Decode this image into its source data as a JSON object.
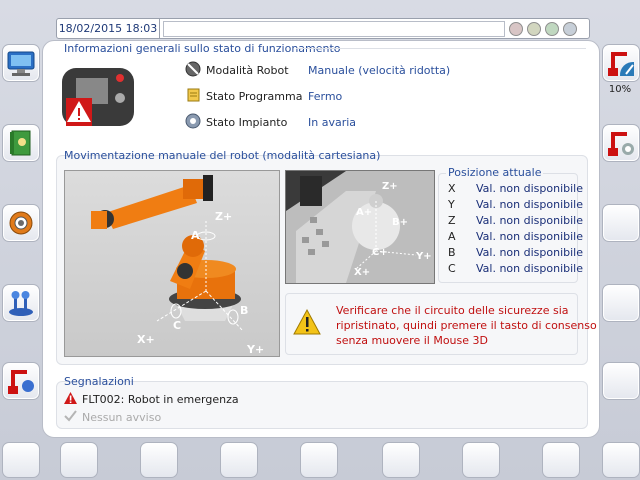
{
  "topbar": {
    "datetime": "18/02/2015 18:03",
    "status_text": ""
  },
  "status_leds": [
    "#d6c7c7",
    "#d0d6bf",
    "#c2d7c2",
    "#c8cfd6"
  ],
  "right_sidebar": {
    "override_value": "10%"
  },
  "general": {
    "title": "Informazioni generali sullo stato di funzionamento",
    "rows": [
      {
        "label": "Modalità Robot",
        "value": "Manuale (velocità ridotta)",
        "icon": "robot-mode-icon"
      },
      {
        "label": "Stato Programma",
        "value": "Fermo",
        "icon": "program-scroll-icon"
      },
      {
        "label": "Stato Impianto",
        "value": "In avaria",
        "icon": "plant-gear-icon"
      }
    ]
  },
  "movement": {
    "title": "Movimentazione manuale del robot (modalità cartesiana)",
    "robot_axes": [
      "Z+",
      "A",
      "C",
      "B",
      "X+",
      "Y+"
    ],
    "mouse_axes": [
      "Z+",
      "A+",
      "B+",
      "C+",
      "Y+",
      "X+"
    ],
    "position": {
      "title": "Posizione attuale",
      "rows": [
        {
          "axis": "X",
          "value": "Val. non disponibile"
        },
        {
          "axis": "Y",
          "value": "Val. non disponibile"
        },
        {
          "axis": "Z",
          "value": "Val. non disponibile"
        },
        {
          "axis": "A",
          "value": "Val. non disponibile"
        },
        {
          "axis": "B",
          "value": "Val. non disponibile"
        },
        {
          "axis": "C",
          "value": "Val. non disponibile"
        }
      ]
    },
    "warning": "Verificare che il circuito delle sicurezze sia ripristinato, quindi premere il tasto di consenso senza muovere il Mouse 3D",
    "warning_lines": [
      "Verificare che il circuito delle sicurezze sia",
      "ripristinato, quindi premere il tasto di consenso",
      "senza muovere il Mouse 3D"
    ]
  },
  "messages": {
    "title": "Segnalazioni",
    "items": [
      {
        "text": "FLT002: Robot in emergenza",
        "icon": "alert-triangle-icon",
        "active": true
      },
      {
        "text": "Nessun avviso",
        "icon": "check-icon",
        "active": false
      }
    ]
  },
  "colors": {
    "accent": "#2a4f9c",
    "warning_text": "#c01010",
    "robot_orange": "#f07d12"
  }
}
